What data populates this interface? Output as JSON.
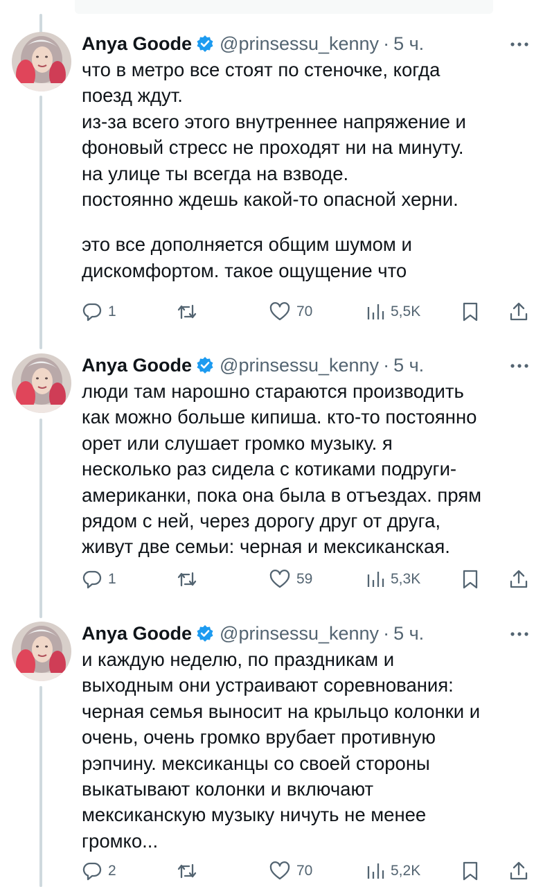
{
  "tweets": [
    {
      "author": "Anya Goode",
      "handle": "@prinsessu_kenny",
      "separator": "·",
      "time": "5 ч.",
      "lines": [
        "что в метро все стоят по стеночке, когда",
        "поезд ждут.",
        "из-за всего этого внутреннее напряжение и",
        "фоновый стресс не проходят ни на минуту.",
        "на улице ты всегда на взводе.",
        "постоянно ждешь какой-то опасной херни.",
        "",
        "это все дополняется общим шумом и",
        "дискомфортом. такое ощущение что"
      ],
      "replies": "1",
      "retweets": "",
      "likes": "70",
      "views": "5,5K"
    },
    {
      "author": "Anya Goode",
      "handle": "@prinsessu_kenny",
      "separator": "·",
      "time": "5 ч.",
      "lines": [
        "люди там нарошно стараются производить",
        "как можно больше кипиша. кто-то постоянно",
        "орет или слушает громко музыку. я",
        "несколько раз сидела с котиками подруги-",
        "американки, пока она была в отъездах. прям",
        "рядом с ней, через дорогу друг от друга,",
        "живут две семьи: черная и мексиканская."
      ],
      "replies": "1",
      "retweets": "",
      "likes": "59",
      "views": "5,3K"
    },
    {
      "author": "Anya Goode",
      "handle": "@prinsessu_kenny",
      "separator": "·",
      "time": "5 ч.",
      "lines": [
        "и каждую неделю, по праздникам и",
        "выходным они устраивают соревнования:",
        "черная семья выносит на крыльцо колонки и",
        "очень, очень громко врубает противную",
        "рэпчину. мексиканцы со своей стороны",
        "выкатывают колонки и включают",
        "мексиканскую музыку ничуть не менее",
        "громко..."
      ],
      "replies": "2",
      "retweets": "",
      "likes": "70",
      "views": "5,2K"
    }
  ],
  "icons": {
    "reply": "reply-icon",
    "retweet": "retweet-icon",
    "like": "like-icon",
    "views": "views-icon",
    "bookmark": "bookmark-icon",
    "share": "share-icon",
    "more": "more-icon",
    "verified": "verified-badge-icon"
  },
  "colors": {
    "text": "#0f1419",
    "secondary": "#536471",
    "verified": "#1d9bf0",
    "thread_line": "#cfd9de"
  }
}
